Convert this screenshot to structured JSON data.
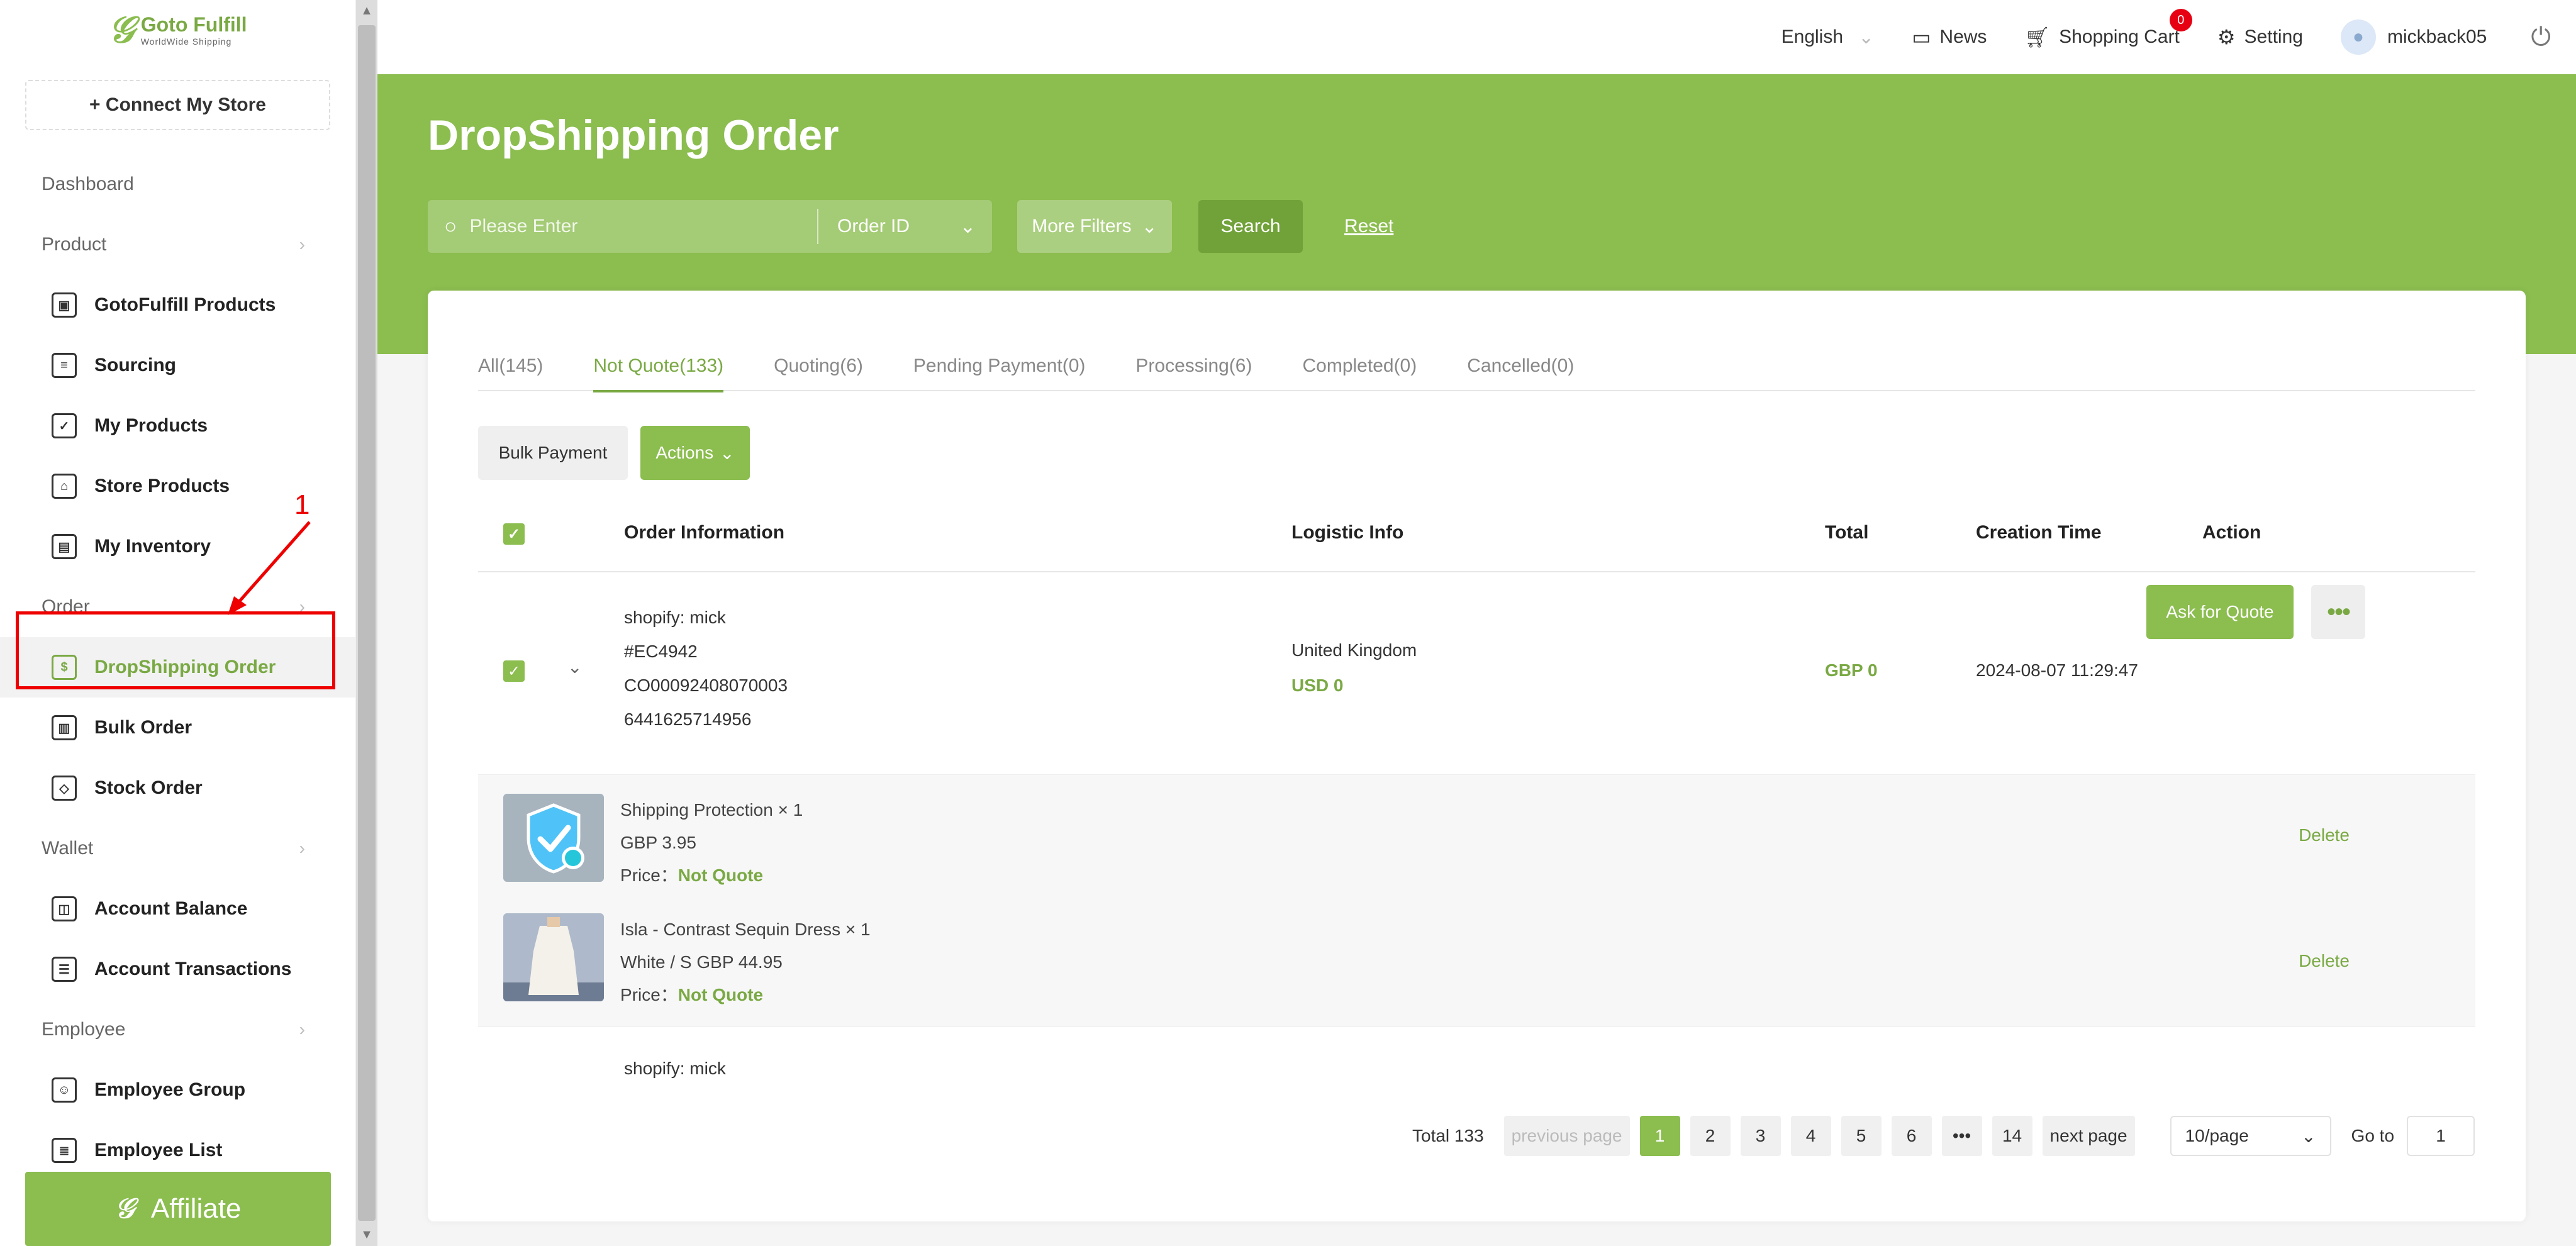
{
  "app": {
    "logo_name": "Goto Fulfill",
    "logo_sub": "WorldWide Shipping",
    "connect_store": "+ Connect My Store",
    "affiliate": "Affiliate"
  },
  "sidebar": {
    "dashboard": "Dashboard",
    "groups": {
      "product": "Product",
      "order": "Order",
      "wallet": "Wallet",
      "employee": "Employee"
    },
    "items": {
      "gotofulfill_products": "GotoFulfill Products",
      "sourcing": "Sourcing",
      "my_products": "My Products",
      "store_products": "Store Products",
      "my_inventory": "My Inventory",
      "dropshipping_order": "DropShipping Order",
      "bulk_order": "Bulk Order",
      "stock_order": "Stock Order",
      "account_balance": "Account Balance",
      "account_transactions": "Account Transactions",
      "employee_group": "Employee Group",
      "employee_list": "Employee List"
    }
  },
  "topbar": {
    "language": "English",
    "news": "News",
    "cart": "Shopping Cart",
    "cart_count": "0",
    "setting": "Setting",
    "username": "mickback05"
  },
  "page": {
    "title": "DropShipping Order",
    "search_placeholder": "Please Enter",
    "search_field": "Order ID",
    "more_filters": "More Filters",
    "search_btn": "Search",
    "reset": "Reset"
  },
  "tabs": [
    {
      "label": "All(145)"
    },
    {
      "label": "Not Quote(133)"
    },
    {
      "label": "Quoting(6)"
    },
    {
      "label": "Pending Payment(0)"
    },
    {
      "label": "Processing(6)"
    },
    {
      "label": "Completed(0)"
    },
    {
      "label": "Cancelled(0)"
    }
  ],
  "toolbar": {
    "bulk_payment": "Bulk Payment",
    "actions": "Actions"
  },
  "table": {
    "headers": {
      "order_info": "Order Information",
      "logistic": "Logistic Info",
      "total": "Total",
      "creation_time": "Creation Time",
      "action": "Action"
    },
    "order": {
      "store": "shopify: mick",
      "order_no": "#EC4942",
      "co_no": "CO00092408070003",
      "shop_id": "6441625714956",
      "country": "United Kingdom",
      "shipping": "USD 0",
      "total": "GBP 0",
      "created": "2024-08-07 11:29:47",
      "ask_quote": "Ask for Quote"
    },
    "items": [
      {
        "name": "Shipping Protection × 1",
        "detail": "GBP 3.95",
        "price_label": "Price：",
        "price_value": "Not Quote",
        "delete": "Delete"
      },
      {
        "name": "Isla - Contrast Sequin Dress × 1",
        "detail": "White / S GBP 44.95",
        "price_label": "Price：",
        "price_value": "Not Quote",
        "delete": "Delete"
      }
    ],
    "next_row_store": "shopify: mick"
  },
  "pagination": {
    "total": "Total 133",
    "prev": "previous page",
    "pages": [
      "1",
      "2",
      "3",
      "4",
      "5",
      "6",
      "•••",
      "14"
    ],
    "next": "next page",
    "page_size": "10/page",
    "goto_label": "Go to",
    "goto_value": "1"
  },
  "annotation": {
    "number": "1"
  },
  "colors": {
    "accent": "#8bbd4f",
    "annotation": "#e00000"
  }
}
